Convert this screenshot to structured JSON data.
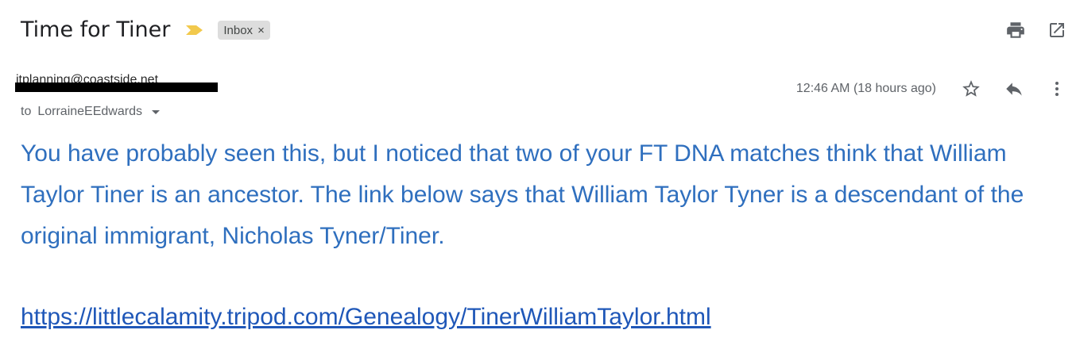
{
  "email": {
    "subject": "Time for Tiner",
    "label": "Inbox",
    "label_remove": "×",
    "sender_redacted": "itplanning@coastside.net",
    "recipient_prefix": "to",
    "recipient": "LorraineEEdwards",
    "timestamp": "12:46 AM (18 hours ago)",
    "body": "You have probably seen this, but I noticed that two of your FT DNA matches think that William Taylor Tiner is an ancestor.   The link below says that William Taylor Tyner is a descendant of the original immigrant, Nicholas Tyner/Tiner.",
    "link": "https://littlecalamity.tripod.com/Genealogy/TinerWilliamTaylor.html"
  },
  "icons": {
    "importance": "importance-marker-icon",
    "print": "print-icon",
    "open_new_window": "open-in-new-window-icon",
    "star": "star-icon",
    "reply": "reply-icon",
    "more": "more-vertical-icon"
  },
  "colors": {
    "body_text": "#2f6fbe",
    "link": "#1f57b8",
    "importance": "#f2c94c",
    "chip_bg": "#dddddd"
  }
}
